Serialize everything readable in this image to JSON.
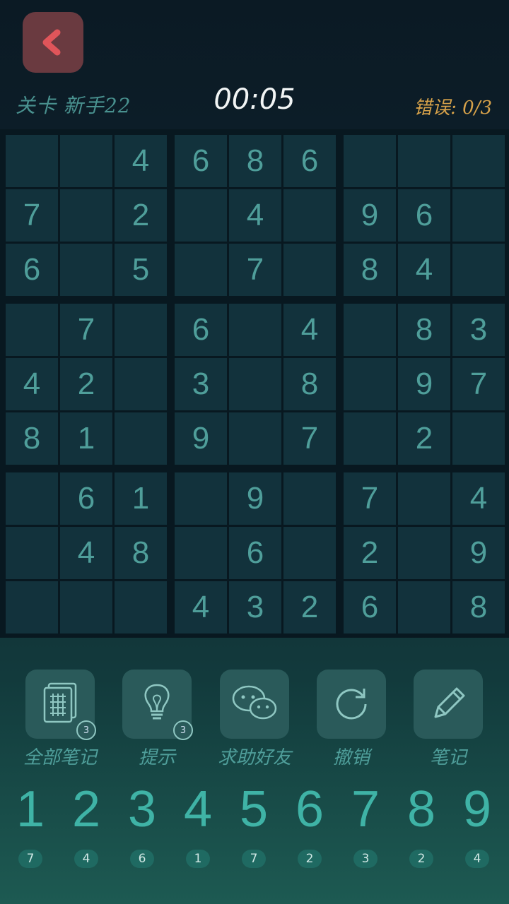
{
  "header": {
    "level": "关卡 新手22",
    "timer": "00:05",
    "errors": "错误: 0/3"
  },
  "colors": {
    "accent": "#3fb3a6",
    "back": "#6a3a40",
    "errors": "#d7a24a"
  },
  "board": [
    [
      "",
      "",
      "4",
      "6",
      "8",
      "6",
      "",
      "",
      ""
    ],
    [
      "7",
      "",
      "2",
      "",
      "4",
      "",
      "9",
      "6",
      ""
    ],
    [
      "6",
      "",
      "5",
      "",
      "7",
      "",
      "8",
      "4",
      ""
    ],
    [
      "",
      "7",
      "",
      "6",
      "",
      "4",
      "",
      "8",
      "3"
    ],
    [
      "4",
      "2",
      "",
      "3",
      "",
      "8",
      "",
      "9",
      "7"
    ],
    [
      "8",
      "1",
      "",
      "9",
      "",
      "7",
      "",
      "2",
      ""
    ],
    [
      "",
      "6",
      "1",
      "",
      "9",
      "",
      "7",
      "",
      "4"
    ],
    [
      "",
      "4",
      "8",
      "",
      "6",
      "",
      "2",
      "",
      "9"
    ],
    [
      "",
      "",
      "",
      "4",
      "3",
      "2",
      "6",
      "",
      "8"
    ]
  ],
  "tools": [
    {
      "label": "全部笔记",
      "icon": "grid-notes-icon",
      "badge": "3"
    },
    {
      "label": "提示",
      "icon": "lightbulb-icon",
      "badge": "3"
    },
    {
      "label": "求助好友",
      "icon": "wechat-icon",
      "badge": ""
    },
    {
      "label": "撤销",
      "icon": "undo-icon",
      "badge": ""
    },
    {
      "label": "笔记",
      "icon": "pencil-icon",
      "badge": ""
    }
  ],
  "numpad": [
    {
      "digit": "1",
      "count": "7"
    },
    {
      "digit": "2",
      "count": "4"
    },
    {
      "digit": "3",
      "count": "6"
    },
    {
      "digit": "4",
      "count": "1"
    },
    {
      "digit": "5",
      "count": "7"
    },
    {
      "digit": "6",
      "count": "2"
    },
    {
      "digit": "7",
      "count": "3"
    },
    {
      "digit": "8",
      "count": "2"
    },
    {
      "digit": "9",
      "count": "4"
    }
  ]
}
